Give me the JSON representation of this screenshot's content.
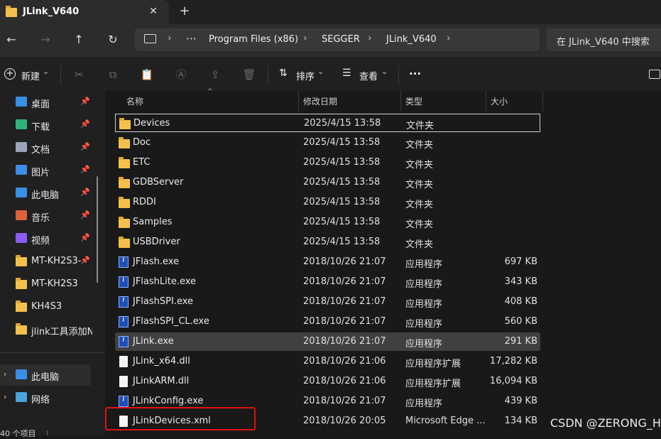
{
  "window": {
    "tab_title": "JLink_V640",
    "close_glyph": "✕",
    "new_tab_glyph": "+"
  },
  "nav": {
    "back_icon": "←",
    "forward_icon": "→",
    "up_icon": "↑",
    "refresh_icon": "↻",
    "more_glyph": "⋯",
    "breadcrumbs": [
      "Program Files (x86)",
      "SEGGER",
      "JLink_V640"
    ],
    "chevron": "›",
    "search_placeholder": "在 JLink_V640 中搜索"
  },
  "toolbar": {
    "new_label": "新建",
    "sort_label": "排序",
    "view_label": "查看",
    "more_glyph": "···",
    "dropdown_glyph": "⌄"
  },
  "sidebar": {
    "pinned": [
      {
        "label": "桌面",
        "icon": "desktop-icon",
        "color": "#3a8ee6"
      },
      {
        "label": "下载",
        "icon": "download-icon",
        "color": "#2fb37a"
      },
      {
        "label": "文档",
        "icon": "document-icon",
        "color": "#9aa6b8"
      },
      {
        "label": "图片",
        "icon": "pictures-icon",
        "color": "#3a8ee6"
      },
      {
        "label": "此电脑",
        "icon": "computer-icon",
        "color": "#3a8ee6"
      },
      {
        "label": "音乐",
        "icon": "music-icon",
        "color": "#e0603a"
      },
      {
        "label": "视频",
        "icon": "video-icon",
        "color": "#8b5cf6"
      },
      {
        "label": "MT-KH2S3-",
        "icon": "folder-icon",
        "color": "#f3c14b"
      }
    ],
    "folders": [
      {
        "label": "MT-KH2S3",
        "icon": "folder-icon"
      },
      {
        "label": "KH4S3",
        "icon": "folder-icon"
      },
      {
        "label": "jlink工具添加Na",
        "icon": "folder-icon"
      }
    ],
    "tree": [
      {
        "label": "此电脑",
        "icon": "computer-icon"
      },
      {
        "label": "网络",
        "icon": "network-icon"
      }
    ],
    "pin_glyph": "📌",
    "expand_glyph": "›",
    "status": "40 个项目"
  },
  "columns": {
    "name": "名称",
    "date": "修改日期",
    "type": "类型",
    "size": "大小"
  },
  "files": [
    {
      "name": "Devices",
      "date": "2025/4/15 13:58",
      "type": "文件夹",
      "size": "",
      "kind": "folder"
    },
    {
      "name": "Doc",
      "date": "2025/4/15 13:58",
      "type": "文件夹",
      "size": "",
      "kind": "folder"
    },
    {
      "name": "ETC",
      "date": "2025/4/15 13:58",
      "type": "文件夹",
      "size": "",
      "kind": "folder"
    },
    {
      "name": "GDBServer",
      "date": "2025/4/15 13:58",
      "type": "文件夹",
      "size": "",
      "kind": "folder"
    },
    {
      "name": "RDDI",
      "date": "2025/4/15 13:58",
      "type": "文件夹",
      "size": "",
      "kind": "folder"
    },
    {
      "name": "Samples",
      "date": "2025/4/15 13:58",
      "type": "文件夹",
      "size": "",
      "kind": "folder"
    },
    {
      "name": "USBDriver",
      "date": "2025/4/15 13:58",
      "type": "文件夹",
      "size": "",
      "kind": "folder"
    },
    {
      "name": "JFlash.exe",
      "date": "2018/10/26 21:07",
      "type": "应用程序",
      "size": "697 KB",
      "kind": "exe",
      "badge": "FLASH"
    },
    {
      "name": "JFlashLite.exe",
      "date": "2018/10/26 21:07",
      "type": "应用程序",
      "size": "343 KB",
      "kind": "exe",
      "badge": "J"
    },
    {
      "name": "JFlashSPI.exe",
      "date": "2018/10/26 21:07",
      "type": "应用程序",
      "size": "408 KB",
      "kind": "exe",
      "badge": "SPI"
    },
    {
      "name": "JFlashSPI_CL.exe",
      "date": "2018/10/26 21:07",
      "type": "应用程序",
      "size": "560 KB",
      "kind": "exe",
      "badge": "SPI"
    },
    {
      "name": "JLink.exe",
      "date": "2018/10/26 21:07",
      "type": "应用程序",
      "size": "291 KB",
      "kind": "exe",
      "badge": "Link"
    },
    {
      "name": "JLink_x64.dll",
      "date": "2018/10/26 21:06",
      "type": "应用程序扩展",
      "size": "17,282 KB",
      "kind": "dll"
    },
    {
      "name": "JLinkARM.dll",
      "date": "2018/10/26 21:06",
      "type": "应用程序扩展",
      "size": "16,094 KB",
      "kind": "dll"
    },
    {
      "name": "JLinkConfig.exe",
      "date": "2018/10/26 21:07",
      "type": "应用程序",
      "size": "439 KB",
      "kind": "exe",
      "badge": "Link"
    },
    {
      "name": "JLinkDevices.xml",
      "date": "2018/10/26 20:05",
      "type": "Microsoft Edge ...",
      "size": "134 KB",
      "kind": "xml"
    }
  ],
  "watermark": "CSDN @ZERONG_H",
  "colors": {
    "highlight_box": "#e01010",
    "selected_row": "#404040",
    "folder": "#f3c14b",
    "exe": "#1f4fb5"
  }
}
